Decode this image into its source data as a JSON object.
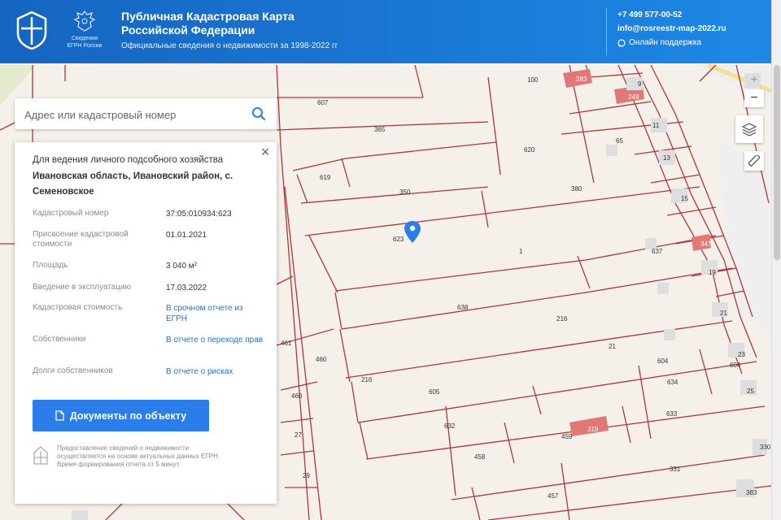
{
  "header": {
    "title_line1": "Публичная Кадастровая Карта",
    "title_line2": "Российской Федерации",
    "subtitle": "Официальные сведения о недвижимости за 1998-2022 гг",
    "emblem_caption_line1": "Сведения",
    "emblem_caption_line2": "ЕГРН России",
    "phone": "+7 499 577-00-52",
    "email": "info@rosreestr-map-2022.ru",
    "support_label": "Онлайн поддержка"
  },
  "search": {
    "placeholder": "Адрес или кадастровый номер"
  },
  "panel": {
    "purpose": "Для ведения личного подсобного хозяйства",
    "address": "Ивановская область, Ивановский район, с. Семеновское",
    "rows": [
      {
        "label": "Кадастровый номер",
        "value": "37:05:010934:623"
      },
      {
        "label": "Присвоение кадастровой стоимости",
        "value": "01.01.2021"
      },
      {
        "label": "Площадь",
        "value": "3 040 м²"
      },
      {
        "label": "Введение в эксплуатацию",
        "value": "17.03.2022"
      },
      {
        "label": "Кадастровая стоимость",
        "value": "В срочном отчете из ЕГРН"
      },
      {
        "label": "Собственники",
        "value": "В отчете о переходе прав"
      },
      {
        "label": "Долги собственников",
        "value": "В отчете о рисках"
      }
    ],
    "docs_button": "Документы по объекту",
    "footnote": "Предоставление сведений о недвижимости осуществляется на основе актуальных данных ЕГРН. Время формирования отчета от 5 минут."
  },
  "map": {
    "zoom_in": "+",
    "zoom_out": "−",
    "parcel_labels": [
      "607",
      "365",
      "100",
      "283",
      "9",
      "249",
      "620",
      "65",
      "11",
      "13",
      "619",
      "350",
      "380",
      "15",
      "623",
      "1",
      "637",
      "347",
      "19",
      "638",
      "216",
      "21",
      "461",
      "460",
      "216",
      "21",
      "604",
      "23",
      "604",
      "25",
      "460",
      "605",
      "632",
      "634",
      "319",
      "459",
      "633",
      "27",
      "458",
      "330",
      "29",
      "331",
      "383",
      "457"
    ]
  },
  "colors": {
    "header_start": "#1565c0",
    "header_end": "#1e88e5",
    "accent": "#2b7de9",
    "parcel_line": "#b0353a",
    "building": "#e07878",
    "map_bg": "#f5f1ea"
  }
}
